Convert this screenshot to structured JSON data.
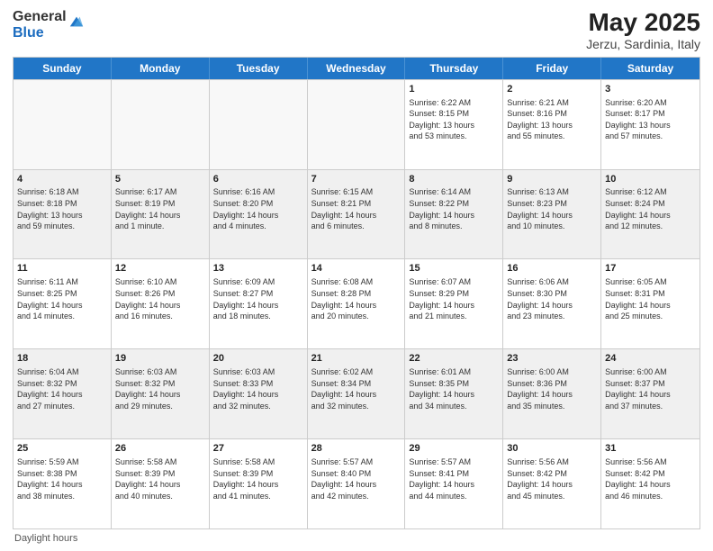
{
  "header": {
    "logo_general": "General",
    "logo_blue": "Blue",
    "title": "May 2025",
    "subtitle": "Jerzu, Sardinia, Italy"
  },
  "days": [
    "Sunday",
    "Monday",
    "Tuesday",
    "Wednesday",
    "Thursday",
    "Friday",
    "Saturday"
  ],
  "weeks": [
    [
      {
        "day": "",
        "empty": true
      },
      {
        "day": "",
        "empty": true
      },
      {
        "day": "",
        "empty": true
      },
      {
        "day": "",
        "empty": true
      },
      {
        "day": "1",
        "lines": [
          "Sunrise: 6:22 AM",
          "Sunset: 8:15 PM",
          "Daylight: 13 hours",
          "and 53 minutes."
        ]
      },
      {
        "day": "2",
        "lines": [
          "Sunrise: 6:21 AM",
          "Sunset: 8:16 PM",
          "Daylight: 13 hours",
          "and 55 minutes."
        ]
      },
      {
        "day": "3",
        "lines": [
          "Sunrise: 6:20 AM",
          "Sunset: 8:17 PM",
          "Daylight: 13 hours",
          "and 57 minutes."
        ]
      }
    ],
    [
      {
        "day": "4",
        "lines": [
          "Sunrise: 6:18 AM",
          "Sunset: 8:18 PM",
          "Daylight: 13 hours",
          "and 59 minutes."
        ]
      },
      {
        "day": "5",
        "lines": [
          "Sunrise: 6:17 AM",
          "Sunset: 8:19 PM",
          "Daylight: 14 hours",
          "and 1 minute."
        ]
      },
      {
        "day": "6",
        "lines": [
          "Sunrise: 6:16 AM",
          "Sunset: 8:20 PM",
          "Daylight: 14 hours",
          "and 4 minutes."
        ]
      },
      {
        "day": "7",
        "lines": [
          "Sunrise: 6:15 AM",
          "Sunset: 8:21 PM",
          "Daylight: 14 hours",
          "and 6 minutes."
        ]
      },
      {
        "day": "8",
        "lines": [
          "Sunrise: 6:14 AM",
          "Sunset: 8:22 PM",
          "Daylight: 14 hours",
          "and 8 minutes."
        ]
      },
      {
        "day": "9",
        "lines": [
          "Sunrise: 6:13 AM",
          "Sunset: 8:23 PM",
          "Daylight: 14 hours",
          "and 10 minutes."
        ]
      },
      {
        "day": "10",
        "lines": [
          "Sunrise: 6:12 AM",
          "Sunset: 8:24 PM",
          "Daylight: 14 hours",
          "and 12 minutes."
        ]
      }
    ],
    [
      {
        "day": "11",
        "lines": [
          "Sunrise: 6:11 AM",
          "Sunset: 8:25 PM",
          "Daylight: 14 hours",
          "and 14 minutes."
        ]
      },
      {
        "day": "12",
        "lines": [
          "Sunrise: 6:10 AM",
          "Sunset: 8:26 PM",
          "Daylight: 14 hours",
          "and 16 minutes."
        ]
      },
      {
        "day": "13",
        "lines": [
          "Sunrise: 6:09 AM",
          "Sunset: 8:27 PM",
          "Daylight: 14 hours",
          "and 18 minutes."
        ]
      },
      {
        "day": "14",
        "lines": [
          "Sunrise: 6:08 AM",
          "Sunset: 8:28 PM",
          "Daylight: 14 hours",
          "and 20 minutes."
        ]
      },
      {
        "day": "15",
        "lines": [
          "Sunrise: 6:07 AM",
          "Sunset: 8:29 PM",
          "Daylight: 14 hours",
          "and 21 minutes."
        ]
      },
      {
        "day": "16",
        "lines": [
          "Sunrise: 6:06 AM",
          "Sunset: 8:30 PM",
          "Daylight: 14 hours",
          "and 23 minutes."
        ]
      },
      {
        "day": "17",
        "lines": [
          "Sunrise: 6:05 AM",
          "Sunset: 8:31 PM",
          "Daylight: 14 hours",
          "and 25 minutes."
        ]
      }
    ],
    [
      {
        "day": "18",
        "lines": [
          "Sunrise: 6:04 AM",
          "Sunset: 8:32 PM",
          "Daylight: 14 hours",
          "and 27 minutes."
        ]
      },
      {
        "day": "19",
        "lines": [
          "Sunrise: 6:03 AM",
          "Sunset: 8:32 PM",
          "Daylight: 14 hours",
          "and 29 minutes."
        ]
      },
      {
        "day": "20",
        "lines": [
          "Sunrise: 6:03 AM",
          "Sunset: 8:33 PM",
          "Daylight: 14 hours",
          "and 32 minutes."
        ]
      },
      {
        "day": "21",
        "lines": [
          "Sunrise: 6:02 AM",
          "Sunset: 8:34 PM",
          "Daylight: 14 hours",
          "and 32 minutes."
        ]
      },
      {
        "day": "22",
        "lines": [
          "Sunrise: 6:01 AM",
          "Sunset: 8:35 PM",
          "Daylight: 14 hours",
          "and 34 minutes."
        ]
      },
      {
        "day": "23",
        "lines": [
          "Sunrise: 6:00 AM",
          "Sunset: 8:36 PM",
          "Daylight: 14 hours",
          "and 35 minutes."
        ]
      },
      {
        "day": "24",
        "lines": [
          "Sunrise: 6:00 AM",
          "Sunset: 8:37 PM",
          "Daylight: 14 hours",
          "and 37 minutes."
        ]
      }
    ],
    [
      {
        "day": "25",
        "lines": [
          "Sunrise: 5:59 AM",
          "Sunset: 8:38 PM",
          "Daylight: 14 hours",
          "and 38 minutes."
        ]
      },
      {
        "day": "26",
        "lines": [
          "Sunrise: 5:58 AM",
          "Sunset: 8:39 PM",
          "Daylight: 14 hours",
          "and 40 minutes."
        ]
      },
      {
        "day": "27",
        "lines": [
          "Sunrise: 5:58 AM",
          "Sunset: 8:39 PM",
          "Daylight: 14 hours",
          "and 41 minutes."
        ]
      },
      {
        "day": "28",
        "lines": [
          "Sunrise: 5:57 AM",
          "Sunset: 8:40 PM",
          "Daylight: 14 hours",
          "and 42 minutes."
        ]
      },
      {
        "day": "29",
        "lines": [
          "Sunrise: 5:57 AM",
          "Sunset: 8:41 PM",
          "Daylight: 14 hours",
          "and 44 minutes."
        ]
      },
      {
        "day": "30",
        "lines": [
          "Sunrise: 5:56 AM",
          "Sunset: 8:42 PM",
          "Daylight: 14 hours",
          "and 45 minutes."
        ]
      },
      {
        "day": "31",
        "lines": [
          "Sunrise: 5:56 AM",
          "Sunset: 8:42 PM",
          "Daylight: 14 hours",
          "and 46 minutes."
        ]
      }
    ]
  ],
  "footer": "Daylight hours"
}
